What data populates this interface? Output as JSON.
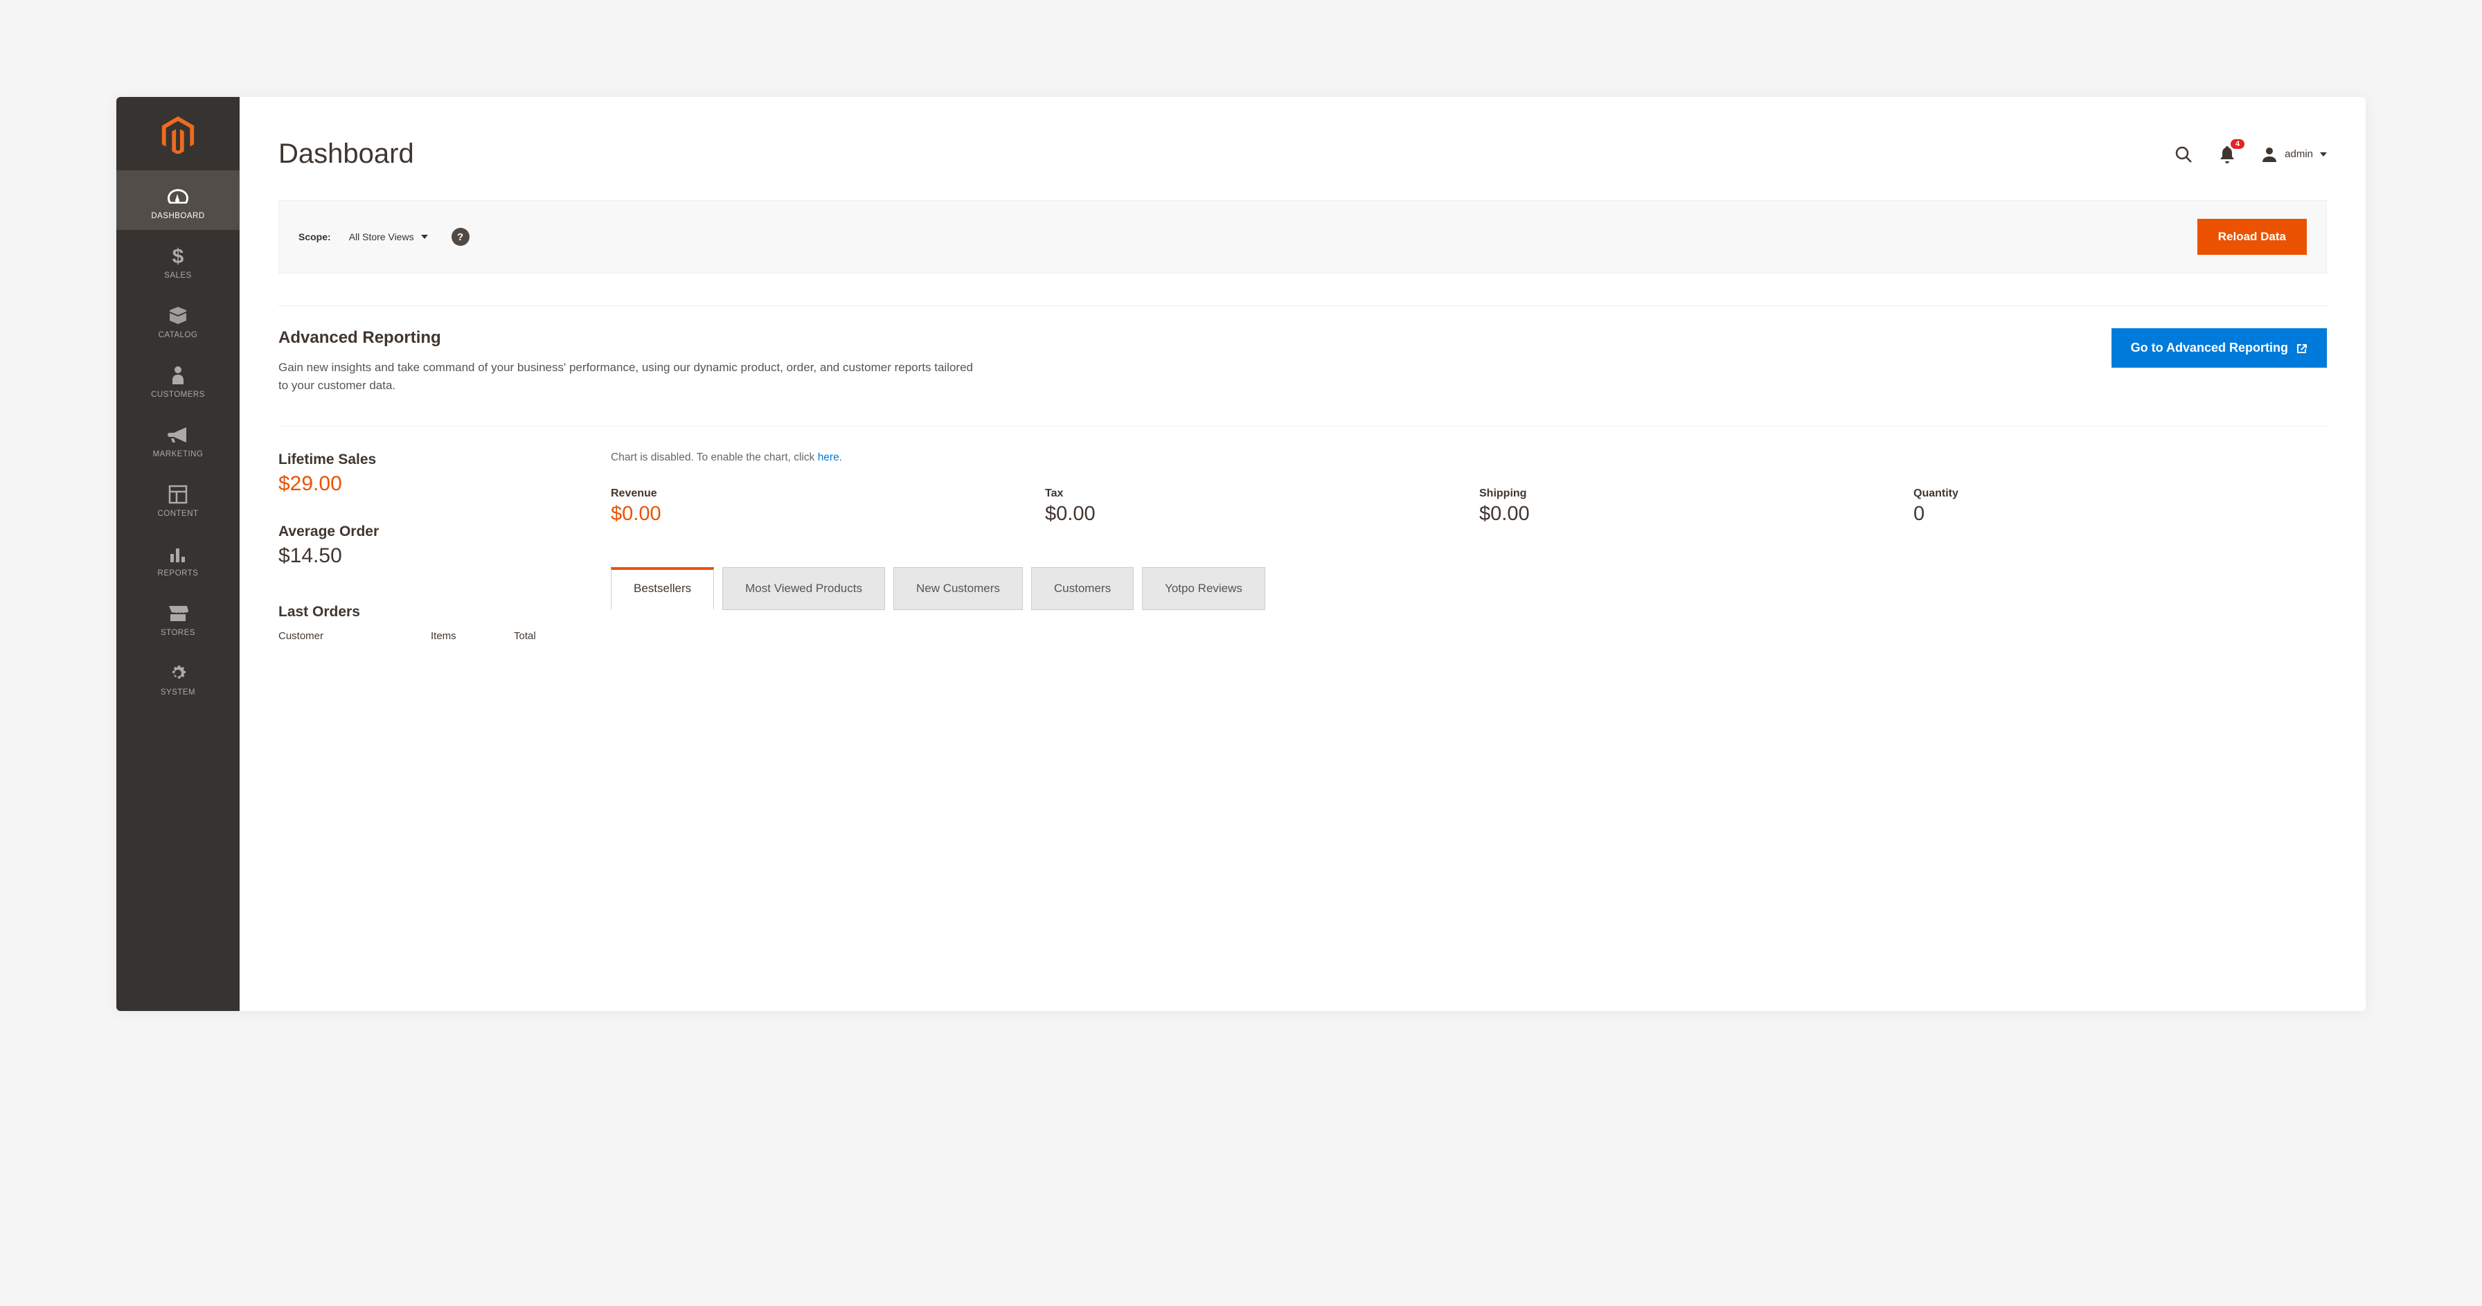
{
  "sidebar": {
    "items": [
      {
        "label": "DASHBOARD",
        "icon": "dashboard"
      },
      {
        "label": "SALES",
        "icon": "dollar"
      },
      {
        "label": "CATALOG",
        "icon": "box"
      },
      {
        "label": "CUSTOMERS",
        "icon": "person"
      },
      {
        "label": "MARKETING",
        "icon": "megaphone"
      },
      {
        "label": "CONTENT",
        "icon": "layout"
      },
      {
        "label": "REPORTS",
        "icon": "bars"
      },
      {
        "label": "STORES",
        "icon": "storefront"
      },
      {
        "label": "SYSTEM",
        "icon": "gear"
      }
    ]
  },
  "header": {
    "title": "Dashboard",
    "notif_count": "4",
    "user_label": "admin"
  },
  "scope": {
    "label": "Scope:",
    "selected": "All Store Views",
    "reload_label": "Reload Data"
  },
  "adv": {
    "title": "Advanced Reporting",
    "desc": "Gain new insights and take command of your business' performance, using our dynamic product, order, and customer reports tailored to your customer data.",
    "button": "Go to Advanced Reporting"
  },
  "stats": {
    "lifetime_label": "Lifetime Sales",
    "lifetime_value": "$29.00",
    "avg_label": "Average Order",
    "avg_value": "$14.50",
    "last_orders_title": "Last Orders",
    "cols": {
      "customer": "Customer",
      "items": "Items",
      "total": "Total"
    }
  },
  "chart": {
    "disabled_prefix": "Chart is disabled. To enable the chart, click ",
    "disabled_link": "here",
    "disabled_suffix": "."
  },
  "metrics": {
    "revenue_label": "Revenue",
    "revenue_value": "$0.00",
    "tax_label": "Tax",
    "tax_value": "$0.00",
    "shipping_label": "Shipping",
    "shipping_value": "$0.00",
    "quantity_label": "Quantity",
    "quantity_value": "0"
  },
  "tabs": [
    "Bestsellers",
    "Most Viewed Products",
    "New Customers",
    "Customers",
    "Yotpo Reviews"
  ]
}
